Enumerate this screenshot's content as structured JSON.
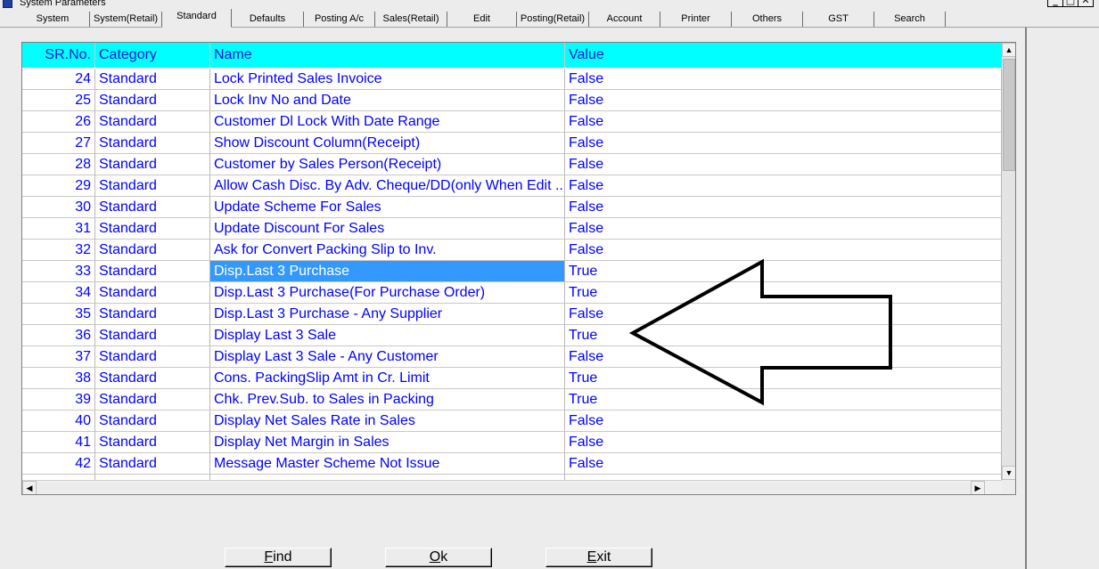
{
  "window": {
    "title": "System Parameters",
    "minimize_glyph": "_",
    "restore_glyph": "□",
    "close_glyph": "✕"
  },
  "tabs": [
    {
      "label": "System"
    },
    {
      "label": "System(Retail)"
    },
    {
      "label": "Standard"
    },
    {
      "label": "Defaults"
    },
    {
      "label": "Posting A/c"
    },
    {
      "label": "Sales(Retail)"
    },
    {
      "label": "Edit"
    },
    {
      "label": "Posting(Retail)"
    },
    {
      "label": "Account"
    },
    {
      "label": "Printer"
    },
    {
      "label": "Others"
    },
    {
      "label": "GST"
    },
    {
      "label": "Search"
    }
  ],
  "active_tab": "Standard",
  "grid": {
    "columns": [
      "SR.No.",
      "Category",
      "Name",
      "Value"
    ],
    "header_color": "#00ffff",
    "text_color": "#0000ff",
    "selected_color": "#3399ff",
    "rows": [
      {
        "sr": "24",
        "category": "Standard",
        "name": "Lock Printed Sales Invoice",
        "value": "False"
      },
      {
        "sr": "25",
        "category": "Standard",
        "name": "Lock Inv No and Date",
        "value": "False"
      },
      {
        "sr": "26",
        "category": "Standard",
        "name": "Customer Dl Lock With Date Range",
        "value": "False"
      },
      {
        "sr": "27",
        "category": "Standard",
        "name": "Show Discount Column(Receipt)",
        "value": "False"
      },
      {
        "sr": "28",
        "category": "Standard",
        "name": "Customer by Sales Person(Receipt)",
        "value": "False"
      },
      {
        "sr": "29",
        "category": "Standard",
        "name": "Allow Cash Disc. By Adv. Cheque/DD(only When Edit ...",
        "value": "False"
      },
      {
        "sr": "30",
        "category": "Standard",
        "name": "Update Scheme For Sales",
        "value": "False"
      },
      {
        "sr": "31",
        "category": "Standard",
        "name": "Update Discount For Sales",
        "value": "False"
      },
      {
        "sr": "32",
        "category": "Standard",
        "name": "Ask for Convert Packing Slip to Inv.",
        "value": "False"
      },
      {
        "sr": "33",
        "category": "Standard",
        "name": "Disp.Last 3 Purchase",
        "value": "True",
        "selected": true
      },
      {
        "sr": "34",
        "category": "Standard",
        "name": "Disp.Last 3 Purchase(For Purchase Order)",
        "value": "True"
      },
      {
        "sr": "35",
        "category": "Standard",
        "name": "Disp.Last 3 Purchase - Any Supplier",
        "value": "False"
      },
      {
        "sr": "36",
        "category": "Standard",
        "name": "Display Last 3 Sale",
        "value": "True"
      },
      {
        "sr": "37",
        "category": "Standard",
        "name": "Display Last 3 Sale - Any Customer",
        "value": "False"
      },
      {
        "sr": "38",
        "category": "Standard",
        "name": "Cons. PackingSlip Amt in Cr. Limit",
        "value": "True"
      },
      {
        "sr": "39",
        "category": "Standard",
        "name": "Chk. Prev.Sub. to Sales in Packing",
        "value": "True"
      },
      {
        "sr": "40",
        "category": "Standard",
        "name": "Display Net Sales Rate in Sales",
        "value": "False"
      },
      {
        "sr": "41",
        "category": "Standard",
        "name": "Display Net Margin in Sales",
        "value": "False"
      },
      {
        "sr": "42",
        "category": "Standard",
        "name": "Message Master Scheme Not Issue",
        "value": "False"
      }
    ]
  },
  "scrollbar": {
    "up_glyph": "▲",
    "down_glyph": "▼",
    "left_glyph": "◀",
    "right_glyph": "▶"
  },
  "buttons": {
    "find": {
      "accel": "F",
      "rest": "ind"
    },
    "ok": {
      "accel": "O",
      "rest": "k"
    },
    "exit": {
      "accel": "E",
      "rest": "xit"
    }
  }
}
